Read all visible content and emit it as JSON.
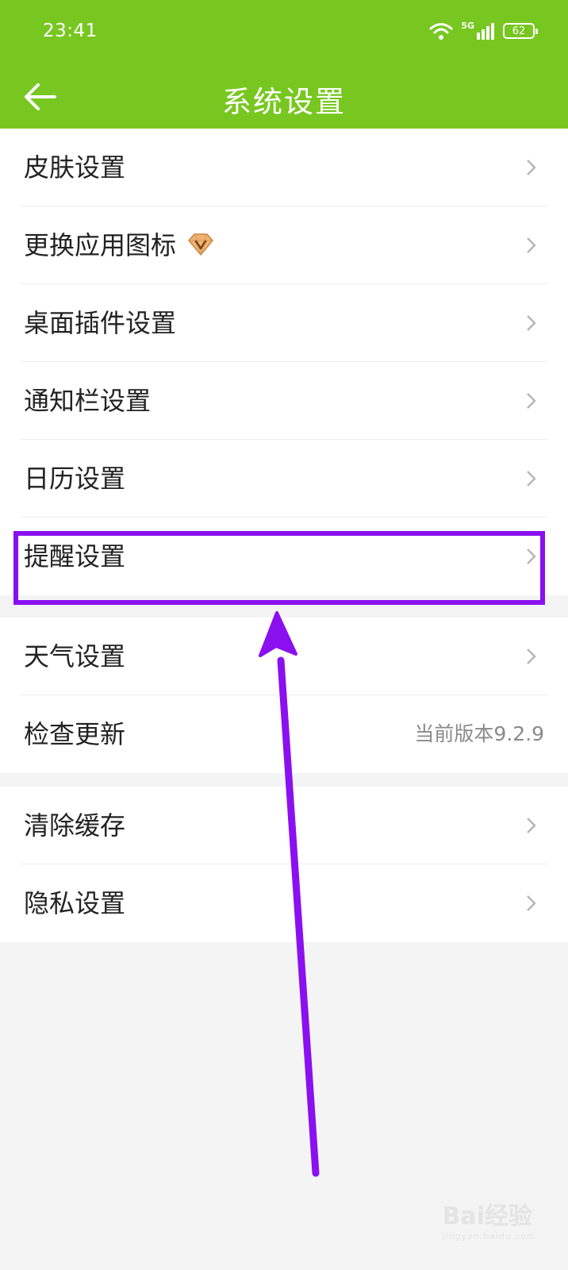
{
  "status_bar": {
    "time": "23:41",
    "network": "5G",
    "battery": "62"
  },
  "header": {
    "title": "系统设置",
    "back_icon": "arrow-left-icon"
  },
  "groups": [
    {
      "items": [
        {
          "label": "皮肤设置"
        },
        {
          "label": "更换应用图标",
          "badge_icon": "diamond-vip-icon"
        },
        {
          "label": "桌面插件设置"
        },
        {
          "label": "通知栏设置"
        },
        {
          "label": "日历设置"
        },
        {
          "label": "提醒设置",
          "highlighted": true
        }
      ]
    },
    {
      "items": [
        {
          "label": "天气设置"
        },
        {
          "label": "检查更新",
          "value": "当前版本9.2.9"
        }
      ]
    },
    {
      "items": [
        {
          "label": "清除缓存"
        },
        {
          "label": "隐私设置"
        }
      ]
    }
  ],
  "colors": {
    "header": "#77c720",
    "annotation": "#8a10f0",
    "background": "#f4f4f4"
  },
  "watermark": {
    "brand": "Bai经验",
    "url": "jingyan.baidu.com"
  }
}
